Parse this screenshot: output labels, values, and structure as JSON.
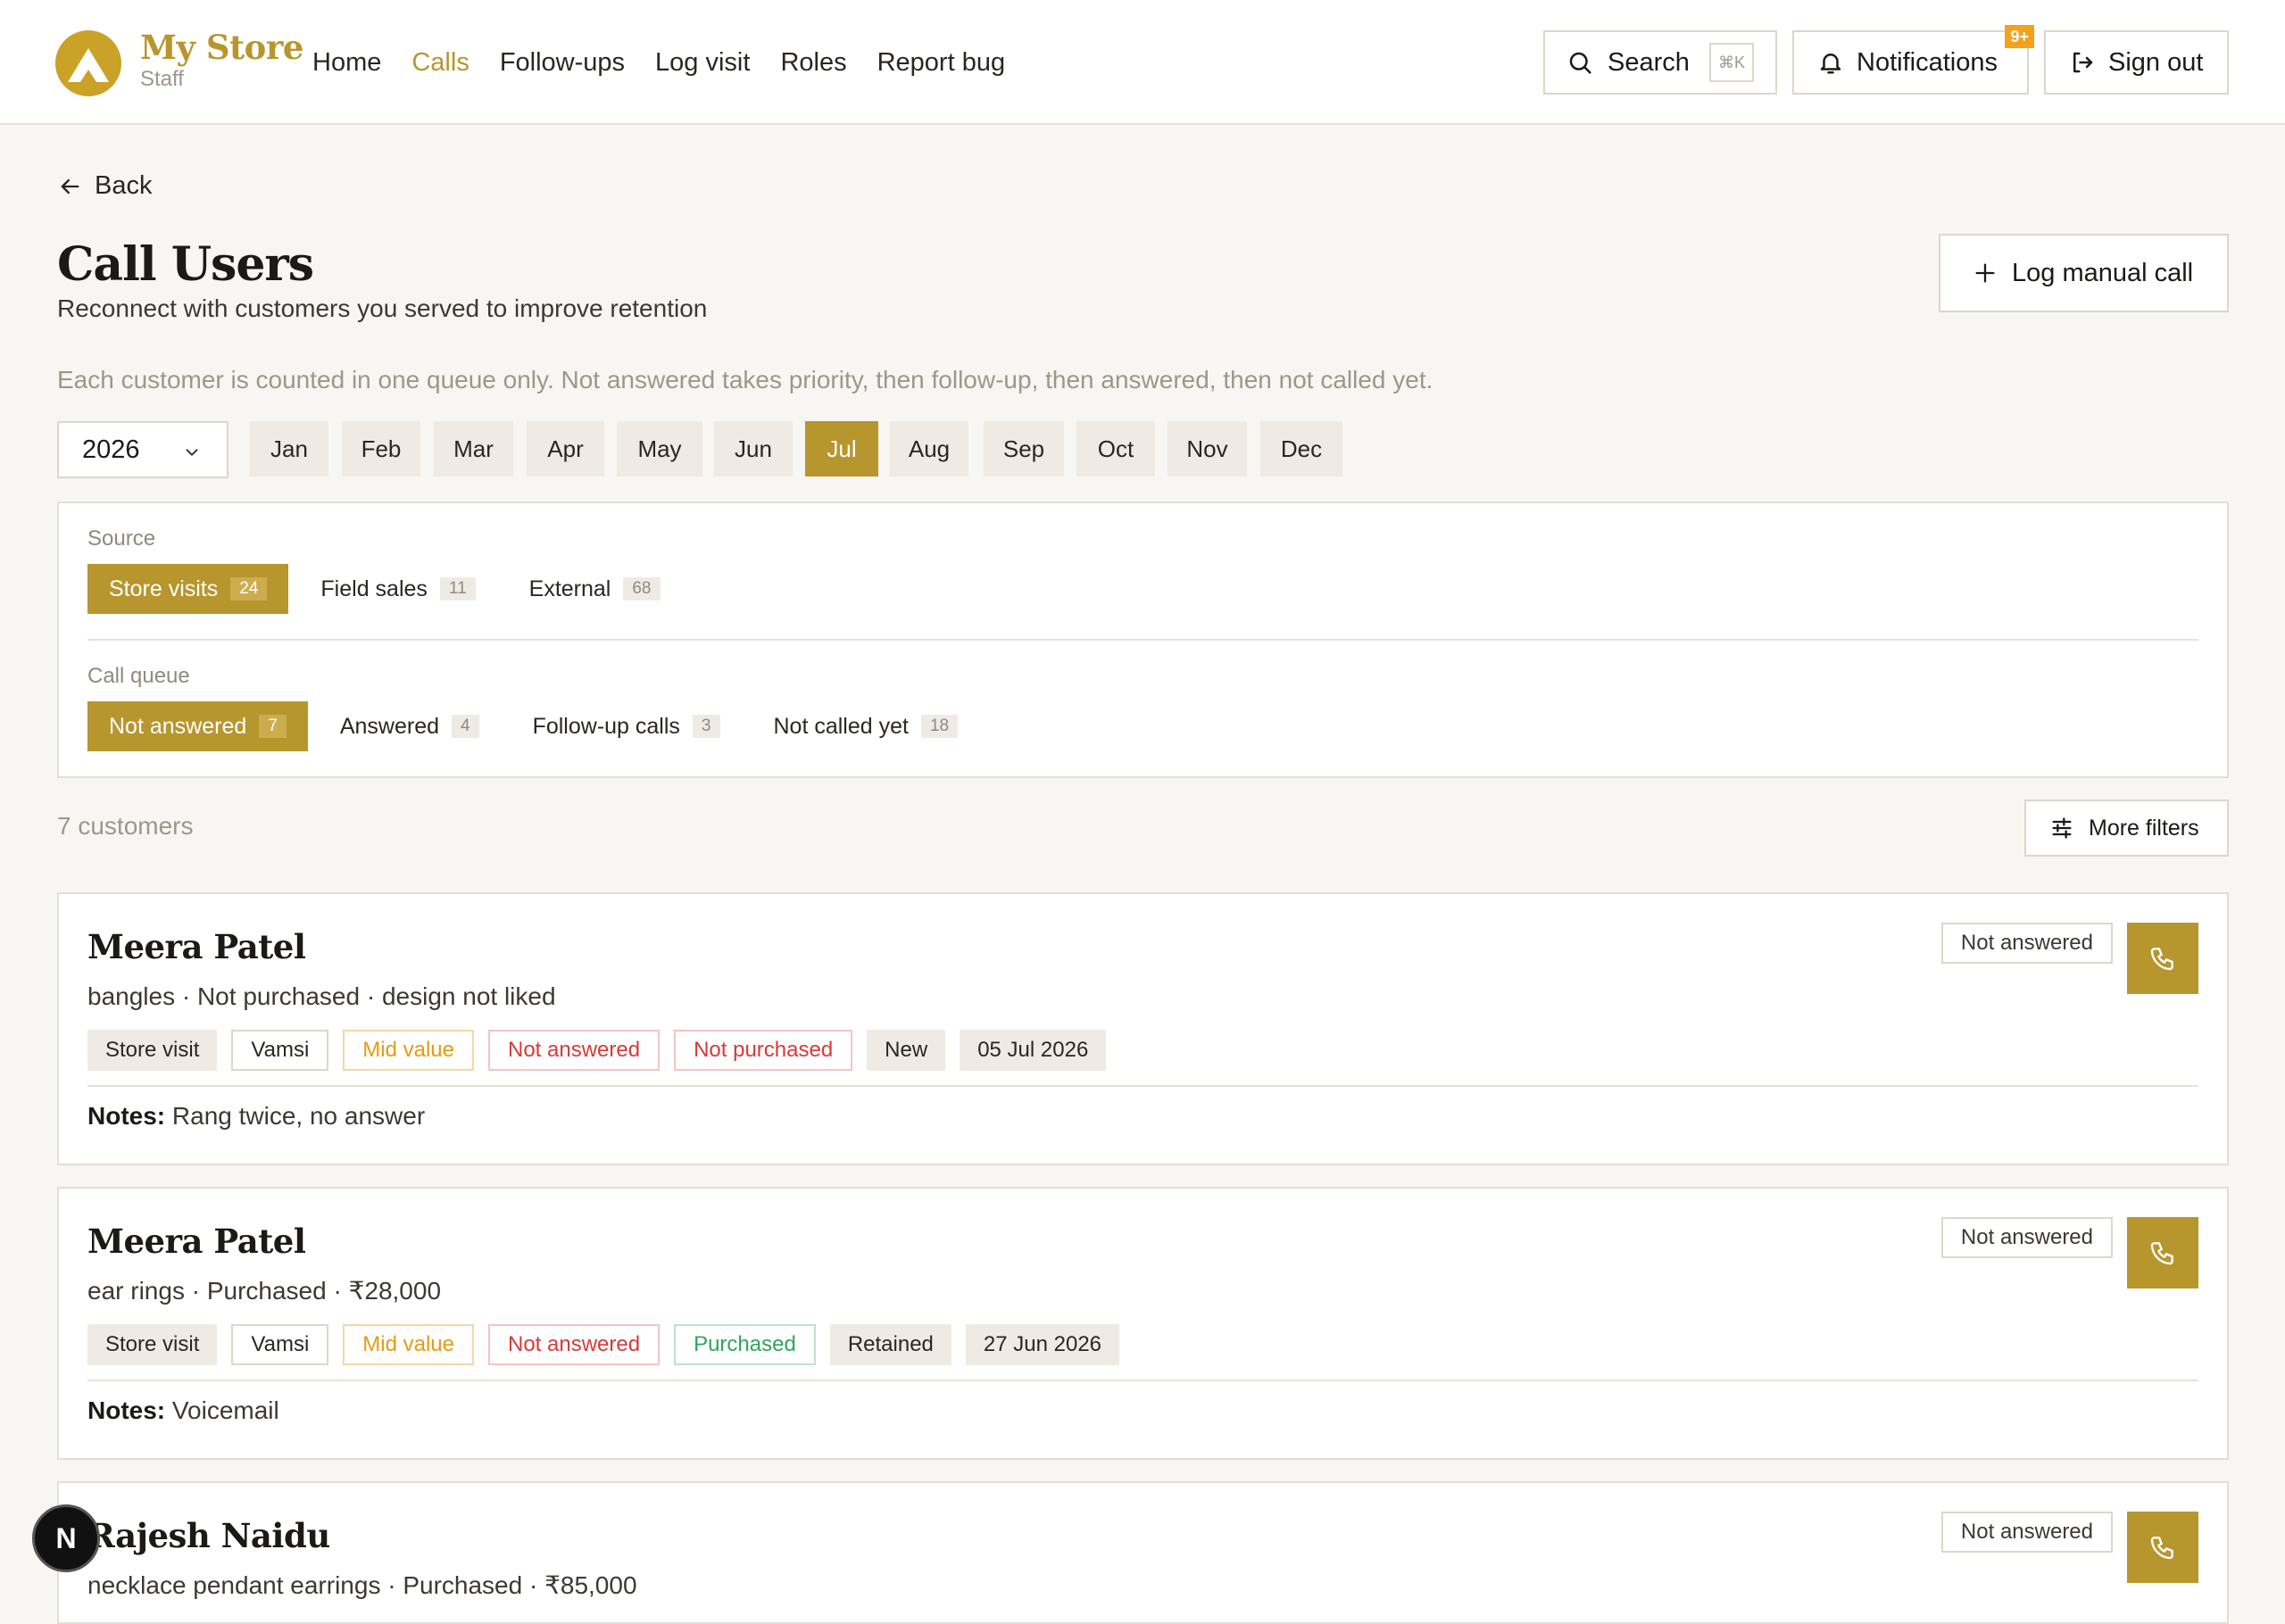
{
  "brand": {
    "name": "My Store",
    "sub": "Staff"
  },
  "nav": [
    {
      "label": "Home"
    },
    {
      "label": "Calls"
    },
    {
      "label": "Follow-ups"
    },
    {
      "label": "Log visit"
    },
    {
      "label": "Roles"
    },
    {
      "label": "Report bug"
    }
  ],
  "header": {
    "search_label": "Search",
    "search_shortcut": "⌘K",
    "notifications_label": "Notifications",
    "notifications_badge": "9+",
    "signout_label": "Sign out"
  },
  "page": {
    "back_label": "Back",
    "title": "Call Users",
    "subtitle": "Reconnect with customers you served to improve retention",
    "log_manual_label": "Log manual call",
    "info": "Each customer is counted in one queue only. Not answered takes priority, then follow-up, then answered, then not called yet."
  },
  "period": {
    "year": "2026",
    "months": [
      "Jan",
      "Feb",
      "Mar",
      "Apr",
      "May",
      "Jun",
      "Jul",
      "Aug",
      "Sep",
      "Oct",
      "Nov",
      "Dec"
    ],
    "selected_month": "Jul"
  },
  "filters": {
    "source_label": "Source",
    "source": [
      {
        "label": "Store visits",
        "count": "24",
        "active": true
      },
      {
        "label": "Field sales",
        "count": "11",
        "active": false
      },
      {
        "label": "External",
        "count": "68",
        "active": false
      }
    ],
    "queue_label": "Call queue",
    "queue": [
      {
        "label": "Not answered",
        "count": "7",
        "active": true
      },
      {
        "label": "Answered",
        "count": "4",
        "active": false
      },
      {
        "label": "Follow-up calls",
        "count": "3",
        "active": false
      },
      {
        "label": "Not called yet",
        "count": "18",
        "active": false
      }
    ]
  },
  "results": {
    "count_text": "7 customers",
    "more_filters_label": "More filters"
  },
  "customers": [
    {
      "name": "Meera Patel",
      "summary": "bangles · Not purchased · design not liked",
      "status": "Not answered",
      "tags": [
        "Store visit",
        "Vamsi",
        "Mid value",
        "Not answered",
        "Not purchased",
        "New",
        "05 Jul 2026"
      ],
      "notes_label": "Notes:",
      "notes": "Rang twice, no answer"
    },
    {
      "name": "Meera Patel",
      "summary": "ear rings · Purchased · ₹28,000",
      "status": "Not answered",
      "tags": [
        "Store visit",
        "Vamsi",
        "Mid value",
        "Not answered",
        "Purchased",
        "Retained",
        "27 Jun 2026"
      ],
      "notes_label": "Notes:",
      "notes": "Voicemail"
    },
    {
      "name": "Rajesh Naidu",
      "summary": "necklace pendant earrings · Purchased · ₹85,000",
      "status": "Not answered"
    }
  ],
  "colors": {
    "accent": "#b8962e",
    "background": "#f8f6f2",
    "badge": "#f4a21c"
  },
  "dev_badge": "N"
}
